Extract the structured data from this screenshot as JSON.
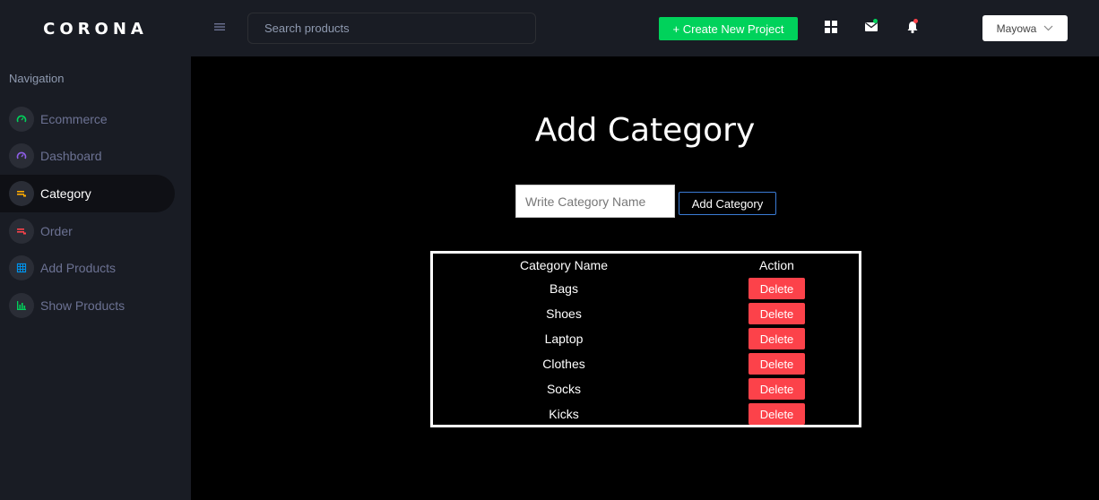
{
  "brand": "CORONA",
  "sidebar": {
    "title": "Navigation",
    "items": [
      {
        "label": "Ecommerce",
        "icon": "speedometer-icon",
        "color": "#00d25b"
      },
      {
        "label": "Dashboard",
        "icon": "speedometer-icon",
        "color": "#8f5fe8"
      },
      {
        "label": "Category",
        "icon": "playlist-icon",
        "color": "#ffab00",
        "active": true
      },
      {
        "label": "Order",
        "icon": "playlist-icon",
        "color": "#fc424a"
      },
      {
        "label": "Add Products",
        "icon": "table-icon",
        "color": "#0090e7"
      },
      {
        "label": "Show Products",
        "icon": "chart-icon",
        "color": "#00d25b"
      }
    ]
  },
  "header": {
    "search_placeholder": "Search products",
    "create_button": "+ Create New Project",
    "user_name": "Mayowa",
    "colors": {
      "accent_green": "#00d25b",
      "alert_red": "#fc424a"
    }
  },
  "main": {
    "title": "Add Category",
    "input_placeholder": "Write Category Name",
    "add_button": "Add Category",
    "table": {
      "headers": [
        "Category Name",
        "Action"
      ],
      "rows": [
        {
          "name": "Bags",
          "action": "Delete"
        },
        {
          "name": "Shoes",
          "action": "Delete"
        },
        {
          "name": "Laptop",
          "action": "Delete"
        },
        {
          "name": "Clothes",
          "action": "Delete"
        },
        {
          "name": "Socks",
          "action": "Delete"
        },
        {
          "name": "Kicks",
          "action": "Delete"
        }
      ]
    }
  }
}
